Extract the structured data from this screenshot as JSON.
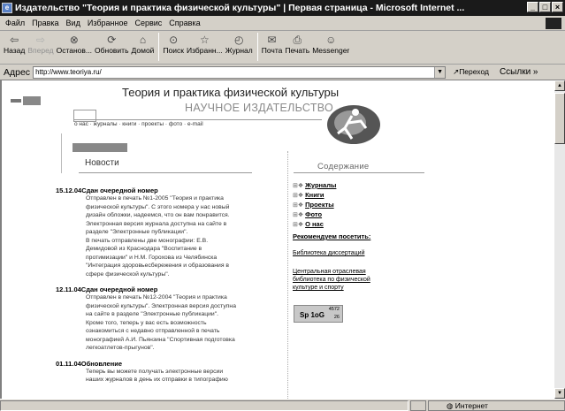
{
  "window": {
    "title": "Издательство \"Теория и практика физической культуры\" | Первая страница - Microsoft Internet ...",
    "buttons": [
      "_",
      "□",
      "×"
    ]
  },
  "menu": [
    "Файл",
    "Правка",
    "Вид",
    "Избранное",
    "Сервис",
    "Справка"
  ],
  "toolbar": {
    "back": "Назад",
    "forward": "Вперед",
    "stop": "Останов...",
    "refresh": "Обновить",
    "home": "Домой",
    "search": "Поиск",
    "favorites": "Избранн...",
    "history": "Журнал",
    "mail": "Почта",
    "print": "Печать",
    "messenger": "Messenger"
  },
  "address": {
    "label": "Адрес",
    "url": "http://www.teoriya.ru/",
    "go": "Переход",
    "links": "Ссылки »"
  },
  "page": {
    "title": "Теория и практика физической культуры",
    "subtitle": "НАУЧНОЕ ИЗДАТЕЛЬСТВО",
    "nav": "о нас  ·  журналы  ·  книги  ·  проекты  ·  фото  ·  e-mail",
    "news_title": "Новости",
    "news": [
      {
        "date": "15.12.04",
        "title": "Сдан очередной номер",
        "body": [
          "Отправлен в печать №1-2005 \"Теория и практика",
          "физической культуры\". С этого номера у нас новый",
          "дизайн обложки, надеемся, что он вам понравится.",
          "Электронная версия журнала доступна на сайте в",
          "разделе \"Электронные публикации\".",
          "В печать отправлены две монографии: Е.В.",
          "Демидовой из Краснодара \"Воспитание в",
          "протимизации\" и Н.М. Горохова из Челябинска",
          "\"Интеграция здоровьесбережения и образования в",
          "сфере физической культуры\"."
        ]
      },
      {
        "date": "12.11.04",
        "title": "Сдан очередной номер",
        "body": [
          "Отправлен в печать №12-2004 \"Теория и практика",
          "физической культуры\". Электронная версия доступна",
          "на сайте в разделе \"Электронные публикации\".",
          "Кроме того, теперь у вас есть возможность",
          "ознакомиться с недавно отправленной в печать",
          "монографией А.И. Пьянзина \"Спортивная подготовка",
          "легкоатлетов-прыгунов\"."
        ]
      },
      {
        "date": "01.11.04",
        "title": "Обновление",
        "body": [
          "Теперь вы можете получать электронные версии",
          "наших журналов в день их отправки в типографию"
        ]
      }
    ],
    "contents_title": "Содержание",
    "contents": [
      "Журналы",
      "Книги",
      "Проекты",
      "Фото",
      "О нас"
    ],
    "recommend": "Рекомендуем посетить:",
    "link_diss": "Библиотека диссертаций",
    "link_lib": "Центральная отраслевая библиотека по физической культуре и спорту",
    "counter_label": "Sp 1oG",
    "counter_top": "4572",
    "counter_bottom": "26"
  },
  "status": {
    "left": "",
    "zone": "Интернет"
  }
}
